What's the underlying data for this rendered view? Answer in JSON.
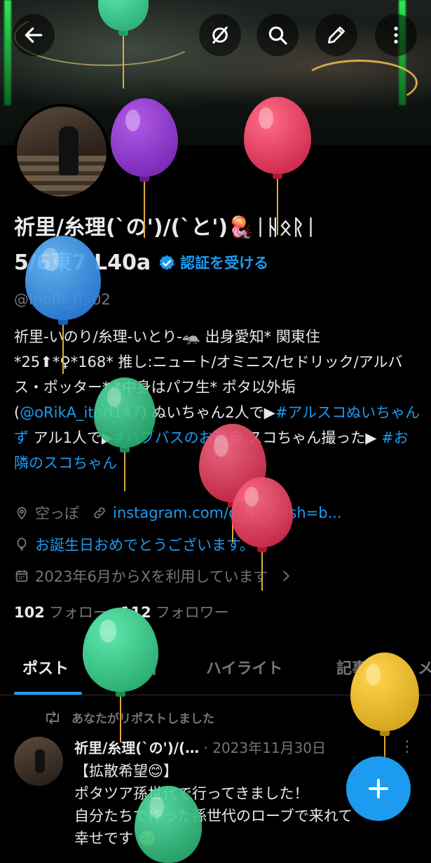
{
  "header": {
    "back_icon": "arrow-left-icon",
    "mute_icon": "slash-circle-icon",
    "search_icon": "search-icon",
    "edit_icon": "pencil-icon",
    "more_icon": "more-vertical-icon"
  },
  "profile": {
    "name_line1": "祈里/糸理(`の')/(`と')🪼ᛁᚺᛟᚱᛁ",
    "name_line2": "5/6東7 L40a",
    "verify_label": "認証を受ける",
    "handle": "@InoRi_0502",
    "bio": {
      "part1": "祈里-いのり/糸理-いとり-🦡 出身愛知* 関東住 *25⬆*♀*168* 推し:ニュート/オミニス/セドリック/アルバス・ポッター* *中身はパフ生* ポタ以外垢(",
      "mention": "@oRikA_itorI147",
      "part2": ") ぬいちゃん2人で▶",
      "hashtag1": "#アルスコぬいちゃんず",
      "part3": " アル1人で▶",
      "hashtag2": "#パブバスのお散歩",
      "part4": " スコちゃん撮った▶ ",
      "hashtag3": "#お隣のスコちゃん"
    },
    "location": "空っぽ",
    "link": "instagram.com/o_ii__?igsh=b...",
    "birthday": "お誕生日おめでとうございます。",
    "joined": "2023年6月からXを利用しています",
    "following_count": "102",
    "following_label": "フォロー",
    "followers_count": "112",
    "followers_label": "フォロワー"
  },
  "tabs": [
    {
      "label": "ポスト",
      "active": true
    },
    {
      "label": "返信",
      "active": false
    },
    {
      "label": "ハイライト",
      "active": false
    },
    {
      "label": "記事",
      "active": false
    },
    {
      "label": "メ",
      "active": false
    }
  ],
  "feed": {
    "repost_label": "あなたがリポストしました",
    "post": {
      "author": "祈里/糸理(`の')/(…",
      "date": "· 2023年11月30日",
      "line1": "【拡散希望😊】",
      "line2": "ポタツア孫世代で行ってきました！",
      "line3": "自分たちで作った孫世代のローブで来れて",
      "line4": "幸せです 🥺"
    }
  },
  "fab": {
    "icon": "plus-icon"
  },
  "colors": {
    "accent": "#1d9bf0",
    "background": "#000000",
    "text": "#e7e9ea",
    "muted": "#71767b"
  }
}
